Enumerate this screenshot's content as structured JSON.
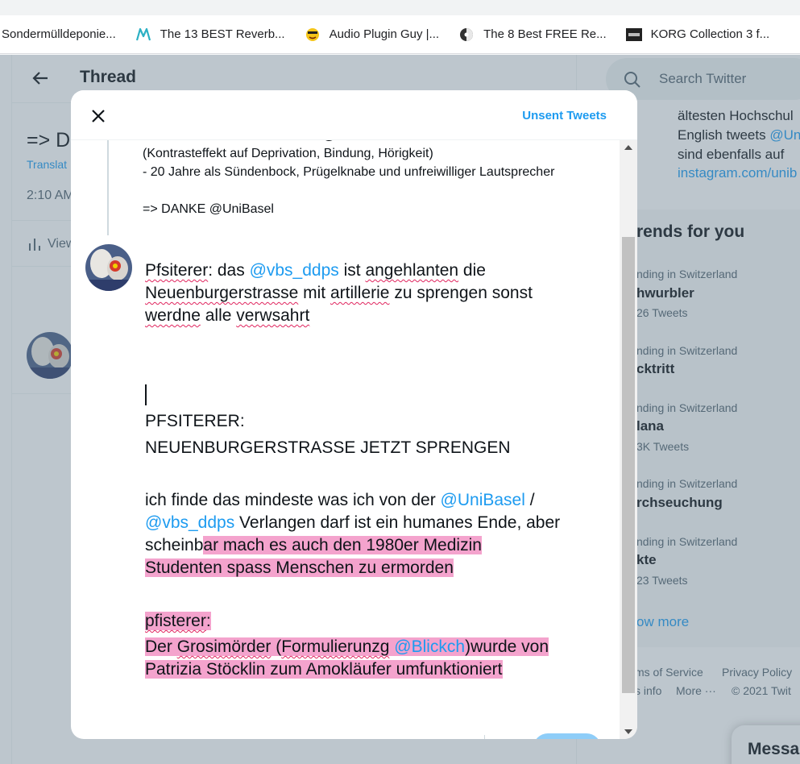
{
  "bookmarks": [
    {
      "label": "Sondermülldeponie...",
      "icon": "none"
    },
    {
      "label": "The 13 BEST Reverb...",
      "icon": "m-logo-icon"
    },
    {
      "label": "Audio Plugin Guy |...",
      "icon": "emoji-face-icon"
    },
    {
      "label": "The 8 Best FREE Re...",
      "icon": "half-circle-icon"
    },
    {
      "label": "KORG Collection 3 f...",
      "icon": "korg-logo-icon"
    }
  ],
  "background": {
    "header_title": "Thread",
    "tweet_start": "=> D",
    "translate": "Translat",
    "timestamp": "2:10 AM",
    "views": "View",
    "search_placeholder": "Search Twitter",
    "bio_lines": [
      "ältesten Hochschul",
      "English tweets ",
      "sind ebenfalls auf",
      "instagram.com/unib"
    ],
    "bio_mention": "@Un",
    "trends_title": "rends for you",
    "trends": [
      {
        "context": "nding in Switzerland",
        "name": "hwurbler",
        "count": "26 Tweets"
      },
      {
        "context": "nding in Switzerland",
        "name": "cktritt",
        "count": ""
      },
      {
        "context": "nding in Switzerland",
        "name": "lana",
        "count": "3K Tweets"
      },
      {
        "context": "nding in Switzerland",
        "name": "rchseuchung",
        "count": ""
      },
      {
        "context": "nding in Switzerland",
        "name": "kte",
        "count": "23 Tweets"
      }
    ],
    "show_more": "ow more",
    "footer_line1": [
      "ms of Service",
      "Privacy Policy"
    ],
    "footer_line2": [
      "s info",
      "More ···",
      "© 2021 Twit"
    ],
    "messages": "Messa"
  },
  "modal": {
    "unsent_label": "Unsent Tweets",
    "prev_tweet": {
      "line0": "Wahr Leben mit Studuine Liam @UniBasel",
      "line1": "(Kontrasteffekt auf Deprivation, Bindung, Hörigkeit)",
      "line2": "- 20 Jahre als Sündenbock, Prügelknabe und unfreiwilliger Lautsprecher",
      "line3": "=> DANKE @UniBasel"
    },
    "compose": {
      "p1_w1": "Pfsiterer",
      "p1_t1": ": das ",
      "p1_m1": "@vbs_ddps",
      "p1_t2": " ist ",
      "p1_w2": "angehlanten",
      "p1_t3": " die",
      "p1_w3": "Neuenburgerstrasse",
      "p1_t4": " mit ",
      "p1_w4": "artillerie",
      "p1_t5": " zu sprengen sonst",
      "p1_w5": "werdne",
      "p1_t6": " alle ",
      "p1_w6": "verwsahrt",
      "p2_l1": "PFSITERER:",
      "p2_l2": "NEUENBURGERSTRASSE JETZT SPRENGEN",
      "p3_t1": "ich finde das mindeste was ich von der ",
      "p3_m1": "@UniBasel",
      "p3_t2": " /",
      "p3_m2": "@vbs_ddps",
      "p3_t3": " Verlangen darf ist ein humanes Ende, aber",
      "p3_t4": "scheinb",
      "p3_h1": "ar mach es auch den 1980er Medizin ",
      "p3_h2": "Studenten spass Menschen zu ermorden",
      "p4_w1": "pfisterer",
      "p4_t1": ":",
      "p4_t2": "Der ",
      "p4_w2": "Grosimörder",
      "p4_t3": " (",
      "p4_w3": "Formulierunzg",
      "p4_t4": " ",
      "p4_m1": "@Blickch",
      "p4_t5": ")wurde von ",
      "p4_t6": "Patrizia Stöcklin zum Amokläufer umfunktioniert "
    }
  },
  "colors": {
    "accent": "#1d9bf0",
    "highlight": "#f4a3cd",
    "spellcheck": "#e0245e"
  }
}
